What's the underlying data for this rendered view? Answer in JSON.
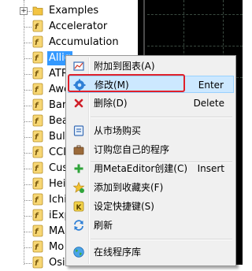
{
  "navigator": {
    "items": [
      {
        "label": "Examples",
        "type": "folder",
        "expander": "+"
      },
      {
        "label": "Accelerator",
        "type": "indicator"
      },
      {
        "label": "Accumulation",
        "type": "indicator"
      },
      {
        "label": "Allig",
        "type": "indicator",
        "selected": true
      },
      {
        "label": "ATR",
        "type": "indicator"
      },
      {
        "label": "Awe",
        "type": "indicator"
      },
      {
        "label": "Bar",
        "type": "indicator"
      },
      {
        "label": "Bea",
        "type": "indicator"
      },
      {
        "label": "Bul",
        "type": "indicator"
      },
      {
        "label": "CCI",
        "type": "indicator"
      },
      {
        "label": "Cus",
        "type": "indicator"
      },
      {
        "label": "Hei",
        "type": "indicator"
      },
      {
        "label": "Ichi",
        "type": "indicator"
      },
      {
        "label": "iExp",
        "type": "indicator"
      },
      {
        "label": "MA",
        "type": "indicator"
      },
      {
        "label": "Mo",
        "type": "indicator"
      },
      {
        "label": "Osi",
        "type": "indicator"
      }
    ]
  },
  "context_menu": {
    "items": [
      {
        "label": "附加到图表(A)",
        "shortcut": "",
        "icon": "chart-attach-icon"
      },
      {
        "label": "修改(M)",
        "shortcut": "Enter",
        "icon": "modify-gear-icon",
        "hover": true
      },
      {
        "label": "删除(D)",
        "shortcut": "Delete",
        "icon": "delete-x-icon"
      },
      {
        "label": "从市场购买",
        "shortcut": "",
        "icon": "market-icon"
      },
      {
        "label": "订购您自己的程序",
        "shortcut": "",
        "icon": "briefcase-icon"
      },
      {
        "label": "用MetaEditor创建(C)",
        "shortcut": "Insert",
        "icon": "plus-icon"
      },
      {
        "label": "添加到收藏夹(F)",
        "shortcut": "",
        "icon": "favorites-star-icon"
      },
      {
        "label": "设定快捷键(S)",
        "shortcut": "",
        "icon": "hotkey-icon"
      },
      {
        "label": "刷新",
        "shortcut": "",
        "icon": "refresh-icon"
      },
      {
        "label": "在线程序库",
        "shortcut": "",
        "icon": "globe-icon"
      }
    ]
  },
  "colors": {
    "selection": "#3399ff",
    "menu_hover": "#cce8ff",
    "highlight_outline": "#e0202a",
    "chart_background": "#000000"
  }
}
